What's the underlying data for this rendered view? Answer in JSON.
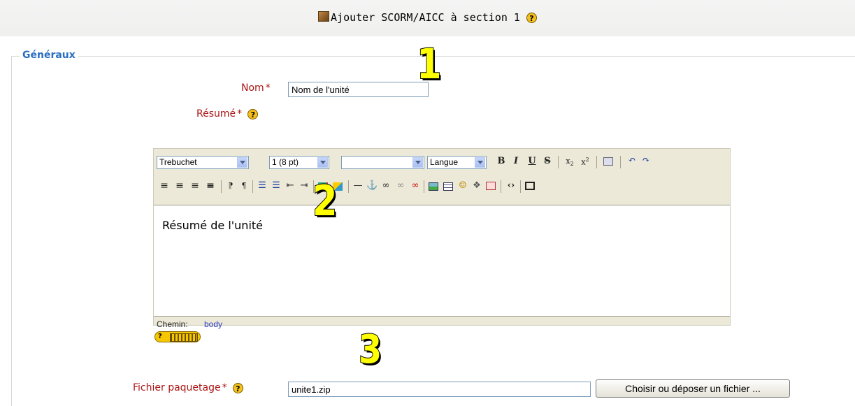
{
  "header": {
    "title": "Ajouter SCORM/AICC à section 1",
    "title_icon": "package-box-icon",
    "help_icon": "help-icon"
  },
  "form": {
    "legend": "Généraux",
    "required_mark": "*",
    "name": {
      "label": "Nom",
      "value": "Nom de l'unité"
    },
    "summary": {
      "label": "Résumé"
    },
    "package": {
      "label": "Fichier paquetage",
      "value": "unite1.zip",
      "button_label": "Choisir ou déposer un fichier ..."
    }
  },
  "editor": {
    "font_select": "Trebuchet",
    "size_select": "1 (8 pt)",
    "format_select": "",
    "lang_select": "Langue",
    "buttons": {
      "bold": "B",
      "italic": "I",
      "underline": "U",
      "strike": "S"
    },
    "content": "Résumé de l'unité",
    "path_label": "Chemin:",
    "path_value": "body"
  },
  "annotations": [
    "1",
    "2",
    "3"
  ],
  "colors": {
    "required": "#aa1515",
    "legend": "#2a6ec0",
    "annotation": "#ffff00"
  }
}
